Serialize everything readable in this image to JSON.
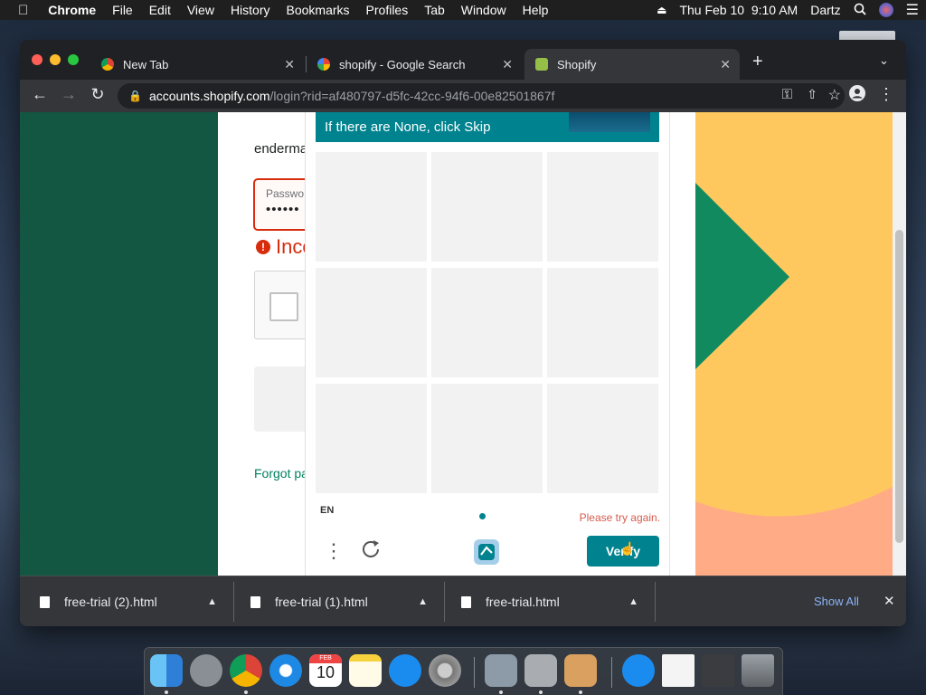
{
  "menubar": {
    "apple_icon": "apple-icon",
    "app_name": "Chrome",
    "items": [
      "File",
      "Edit",
      "View",
      "History",
      "Bookmarks",
      "Profiles",
      "Tab",
      "Window",
      "Help"
    ],
    "datetime": "Thu Feb 10  9:10 AM",
    "user": "Dartz"
  },
  "browser": {
    "tabs": [
      {
        "title": "New Tab",
        "icon": "chrome-icon"
      },
      {
        "title": "shopify - Google Search",
        "icon": "google-icon"
      },
      {
        "title": "Shopify",
        "icon": "shopify-icon",
        "active": true
      }
    ],
    "url_host": "accounts.shopify.com",
    "url_path": "/login?rid=af480797-d5fc-42cc-94f6-00e82501867f"
  },
  "login": {
    "email_partial": "enderma",
    "password_label": "Passwo",
    "password_value": "••••••",
    "error_text": "Inco",
    "forgot_link": "Forgot pa"
  },
  "captcha": {
    "banner_text": "If there are None, click Skip",
    "language": "EN",
    "error_message": "Please try again.",
    "verify_label": "Verify"
  },
  "downloads": {
    "items": [
      "free-trial (2).html",
      "free-trial (1).html",
      "free-trial.html"
    ],
    "show_all": "Show All"
  },
  "dock": {
    "calendar_month": "FEB",
    "calendar_day": "10"
  },
  "colors": {
    "shopify_green": "#135743",
    "captcha_teal": "#00838f",
    "error_red": "#d82c0d",
    "art_yellow": "#ffc85e",
    "art_salmon": "#ffab86"
  }
}
